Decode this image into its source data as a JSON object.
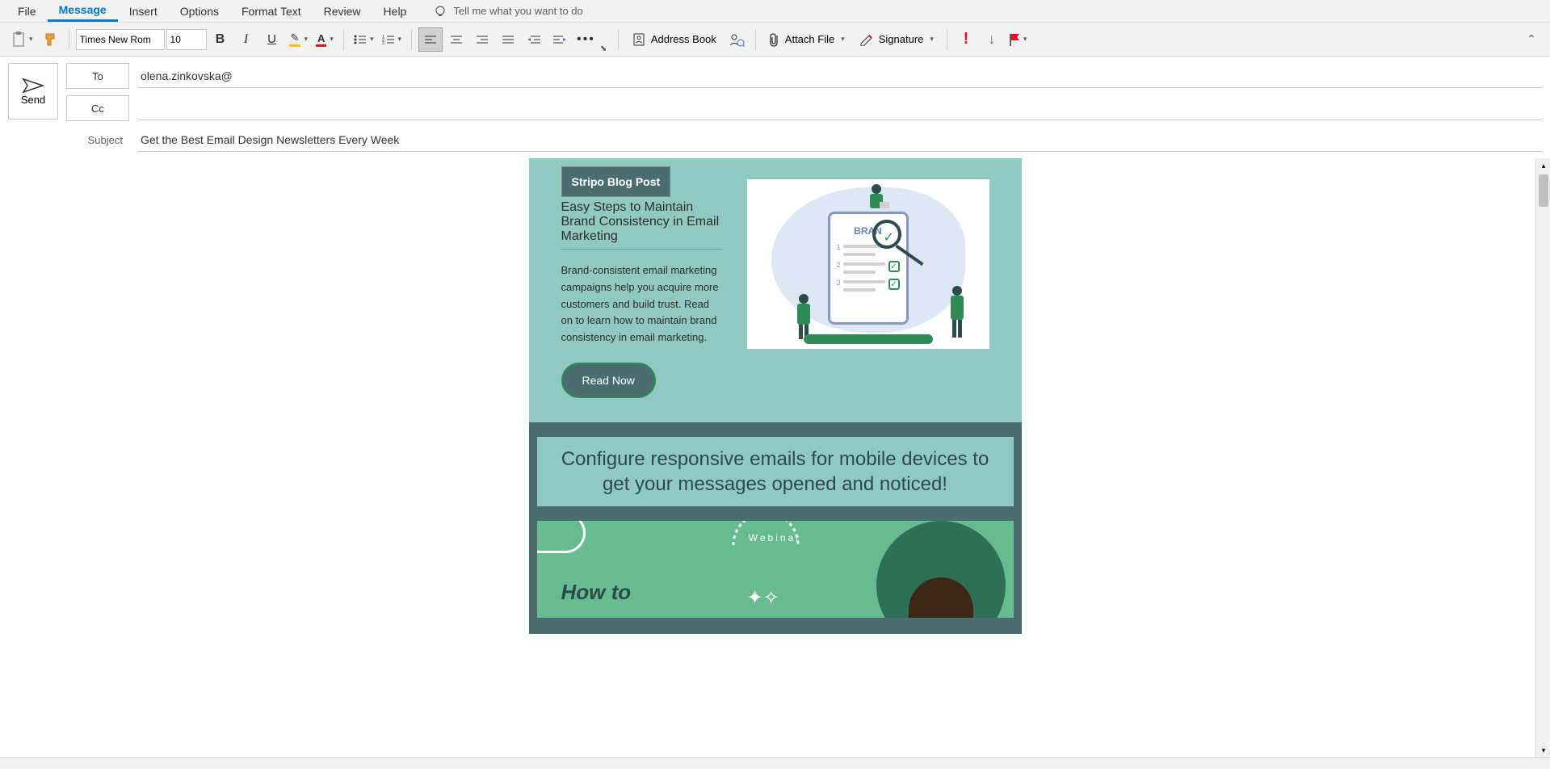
{
  "menus": {
    "file": "File",
    "message": "Message",
    "insert": "Insert",
    "options": "Options",
    "format_text": "Format Text",
    "review": "Review",
    "help": "Help",
    "tell_me": "Tell me what you want to do"
  },
  "ribbon": {
    "font_name": "Times New Rom",
    "font_size": "10",
    "address_book": "Address Book",
    "attach_file": "Attach File",
    "signature": "Signature"
  },
  "header": {
    "send": "Send",
    "to_label": "To",
    "cc_label": "Cc",
    "subject_label": "Subject",
    "to_value": "olena.zinkovska@",
    "cc_value": "",
    "subject_value": "Get the Best Email Design Newsletters Every Week"
  },
  "email": {
    "blog_label": "Stripo Blog Post",
    "blog_title": "Easy Steps to Maintain Brand Consistency in Email Marketing",
    "blog_text": "Brand-consistent email marketing campaigns help you acquire more customers and build trust. Read on to learn how to maintain brand consistency in email marketing.",
    "blog_btn": "Read Now",
    "brand_word": "BRAN",
    "banner_text": "Configure responsive emails for mobile devices to get your messages opened and noticed!",
    "webinar_badge": "Webinar",
    "webinar_title": "How to"
  }
}
